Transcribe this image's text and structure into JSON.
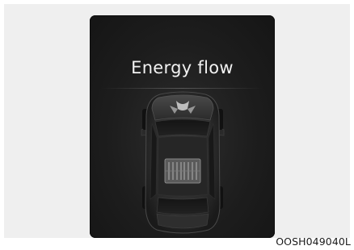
{
  "screen": {
    "title": "Energy flow"
  },
  "figure": {
    "code": "OOSH049040L"
  },
  "colors": {
    "screen_background": "#1d1d1d",
    "title_text": "#f2f2f2",
    "caption_text": "#1a1a1a",
    "outer_panel": "#efefef"
  },
  "icons": {
    "vehicle": "car-topview-icon",
    "battery": "battery-icon"
  }
}
